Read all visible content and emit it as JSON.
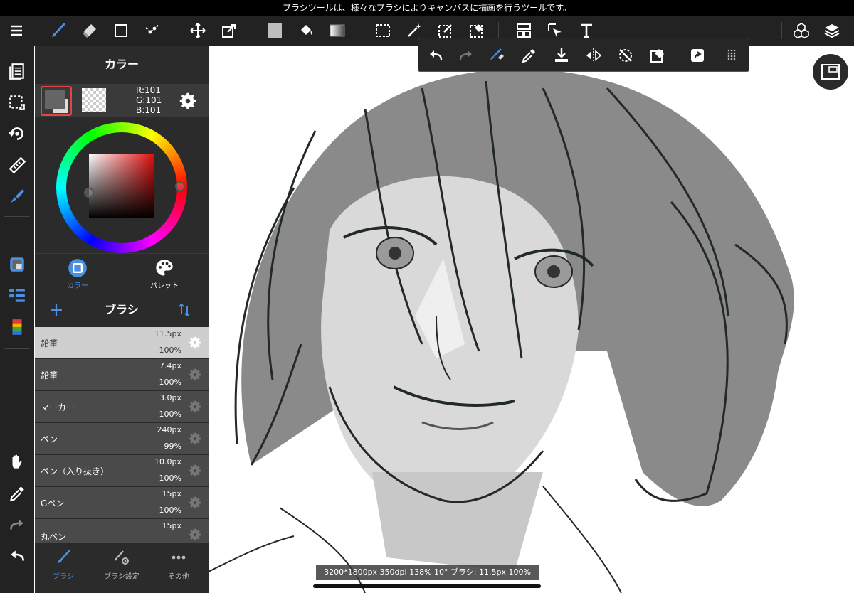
{
  "hint_bar": {
    "text": "ブラシツールは、様々なブラシによりキャンバスに描画を行うツールです。"
  },
  "color_panel": {
    "title": "カラー",
    "rgb": {
      "r": "R:101",
      "g": "G:101",
      "b": "B:101"
    },
    "main_color": "#656565",
    "tabs": [
      {
        "label": "カラー",
        "active": true
      },
      {
        "label": "パレット",
        "active": false
      }
    ]
  },
  "brush_panel": {
    "title": "ブラシ",
    "items": [
      {
        "name": "鉛筆",
        "size": "11.5px",
        "opacity": "100%",
        "selected": true
      },
      {
        "name": "鉛筆",
        "size": "7.4px",
        "opacity": "100%",
        "selected": false
      },
      {
        "name": "マーカー",
        "size": "3.0px",
        "opacity": "100%",
        "selected": false
      },
      {
        "name": "ペン",
        "size": "240px",
        "opacity": "99%",
        "selected": false
      },
      {
        "name": "ペン（入り抜き）",
        "size": "10.0px",
        "opacity": "100%",
        "selected": false
      },
      {
        "name": "Gペン",
        "size": "15px",
        "opacity": "100%",
        "selected": false
      },
      {
        "name": "丸ペン",
        "size": "15px",
        "opacity": "",
        "selected": false
      }
    ]
  },
  "bottom_tabs": [
    {
      "label": "ブラシ",
      "icon": "brush-icon",
      "active": true
    },
    {
      "label": "ブラシ設定",
      "icon": "brush-settings-icon",
      "active": false
    },
    {
      "label": "その他",
      "icon": "more-icon",
      "active": false
    }
  ],
  "status_bar": {
    "text": "3200*1800px 350dpi 138% 10° ブラシ: 11.5px 100%"
  },
  "colors": {
    "accent": "#4a90e2",
    "selected_border": "#e04646",
    "toolbar_bg": "#222222"
  }
}
